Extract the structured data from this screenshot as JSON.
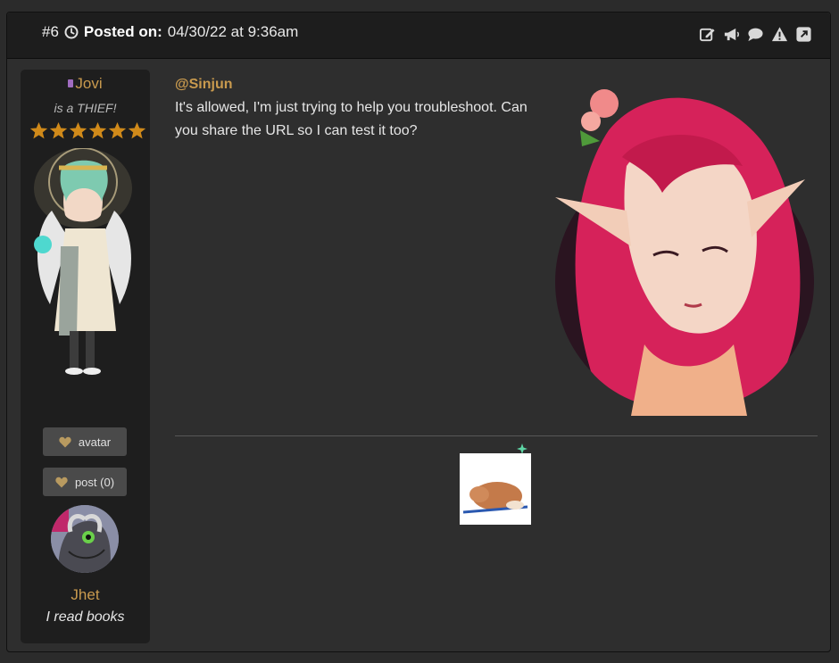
{
  "header": {
    "post_number": "#6",
    "posted_label": "Posted on:",
    "posted_date": "04/30/22 at 9:36am",
    "icons": [
      "edit-icon",
      "megaphone-icon",
      "speech-bubble-icon",
      "warning-icon",
      "external-link-icon"
    ]
  },
  "sidebar": {
    "username": "Jovi",
    "user_title": "is a THIEF!",
    "star_rating": 6,
    "avatar_button": "avatar",
    "post_button": "post (0)",
    "pet_name": "Jhet",
    "pet_description": "I read books"
  },
  "post": {
    "mention": "@Sinjun",
    "message": "It's allowed, I'm just trying to help you troubleshoot. Can you share the URL so I can test it too?"
  },
  "colors": {
    "accent": "#c99a4e",
    "background": "#2e2e2e",
    "header": "#1d1d1d",
    "sidebar": "#1e1e1e",
    "button": "#4a4a4a",
    "star": "#d08a1a"
  }
}
